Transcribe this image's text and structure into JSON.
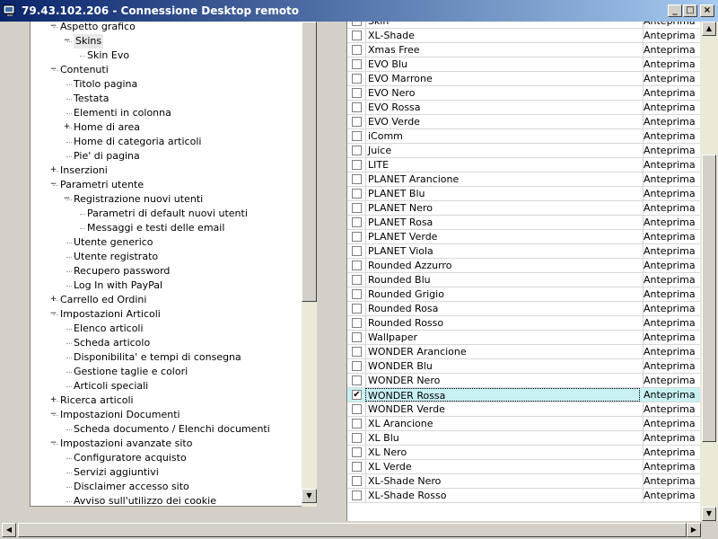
{
  "window": {
    "title": "79.43.102.206 - Connessione Desktop remoto"
  },
  "tree": [
    {
      "label": "Aspetto grafico",
      "level": 1,
      "expander": "minus"
    },
    {
      "label": "Skins",
      "level": 2,
      "expander": "minus",
      "selected": true
    },
    {
      "label": "Skin Evo",
      "level": 3,
      "expander": ""
    },
    {
      "label": "Contenuti",
      "level": 1,
      "expander": "minus"
    },
    {
      "label": "Titolo pagina",
      "level": 2,
      "expander": ""
    },
    {
      "label": "Testata",
      "level": 2,
      "expander": ""
    },
    {
      "label": "Elementi in colonna",
      "level": 2,
      "expander": ""
    },
    {
      "label": "Home di area",
      "level": 2,
      "expander": "plus"
    },
    {
      "label": "Home di categoria articoli",
      "level": 2,
      "expander": ""
    },
    {
      "label": "Pie' di pagina",
      "level": 2,
      "expander": ""
    },
    {
      "label": "Inserzioni",
      "level": 1,
      "expander": "plus"
    },
    {
      "label": "Parametri utente",
      "level": 1,
      "expander": "minus"
    },
    {
      "label": "Registrazione nuovi utenti",
      "level": 2,
      "expander": "minus"
    },
    {
      "label": "Parametri di default nuovi utenti",
      "level": 3,
      "expander": ""
    },
    {
      "label": "Messaggi e testi delle email",
      "level": 3,
      "expander": ""
    },
    {
      "label": "Utente generico",
      "level": 2,
      "expander": ""
    },
    {
      "label": "Utente registrato",
      "level": 2,
      "expander": ""
    },
    {
      "label": "Recupero password",
      "level": 2,
      "expander": ""
    },
    {
      "label": "Log In with PayPal",
      "level": 2,
      "expander": ""
    },
    {
      "label": "Carrello ed Ordini",
      "level": 1,
      "expander": "plus"
    },
    {
      "label": "Impostazioni Articoli",
      "level": 1,
      "expander": "minus"
    },
    {
      "label": "Elenco articoli",
      "level": 2,
      "expander": ""
    },
    {
      "label": "Scheda articolo",
      "level": 2,
      "expander": ""
    },
    {
      "label": "Disponibilita' e tempi di consegna",
      "level": 2,
      "expander": ""
    },
    {
      "label": "Gestione taglie e colori",
      "level": 2,
      "expander": ""
    },
    {
      "label": "Articoli speciali",
      "level": 2,
      "expander": ""
    },
    {
      "label": "Ricerca articoli",
      "level": 1,
      "expander": "plus"
    },
    {
      "label": "Impostazioni Documenti",
      "level": 1,
      "expander": "minus"
    },
    {
      "label": "Scheda documento / Elenchi documenti",
      "level": 2,
      "expander": ""
    },
    {
      "label": "Impostazioni avanzate sito",
      "level": 1,
      "expander": "minus"
    },
    {
      "label": "Configuratore acquisto",
      "level": 2,
      "expander": ""
    },
    {
      "label": "Servizi aggiuntivi",
      "level": 2,
      "expander": ""
    },
    {
      "label": "Disclaimer accesso sito",
      "level": 2,
      "expander": ""
    },
    {
      "label": "Avviso sull'utilizzo dei cookie",
      "level": 2,
      "expander": ""
    }
  ],
  "grid": {
    "preview_label": "Anteprima",
    "rows": [
      {
        "name": "Skin",
        "checked": false
      },
      {
        "name": "XL-Shade",
        "checked": false
      },
      {
        "name": "Xmas Free",
        "checked": false
      },
      {
        "name": "EVO Blu",
        "checked": false
      },
      {
        "name": "EVO Marrone",
        "checked": false
      },
      {
        "name": "EVO Nero",
        "checked": false
      },
      {
        "name": "EVO Rossa",
        "checked": false
      },
      {
        "name": "EVO Verde",
        "checked": false
      },
      {
        "name": "iComm",
        "checked": false
      },
      {
        "name": "Juice",
        "checked": false
      },
      {
        "name": "LITE",
        "checked": false
      },
      {
        "name": "PLANET Arancione",
        "checked": false
      },
      {
        "name": "PLANET Blu",
        "checked": false
      },
      {
        "name": "PLANET Nero",
        "checked": false
      },
      {
        "name": "PLANET Rosa",
        "checked": false
      },
      {
        "name": "PLANET Verde",
        "checked": false
      },
      {
        "name": "PLANET Viola",
        "checked": false
      },
      {
        "name": "Rounded Azzurro",
        "checked": false
      },
      {
        "name": "Rounded Blu",
        "checked": false
      },
      {
        "name": "Rounded Grigio",
        "checked": false
      },
      {
        "name": "Rounded Rosa",
        "checked": false
      },
      {
        "name": "Rounded Rosso",
        "checked": false
      },
      {
        "name": "Wallpaper",
        "checked": false
      },
      {
        "name": "WONDER Arancione",
        "checked": false
      },
      {
        "name": "WONDER Blu",
        "checked": false
      },
      {
        "name": "WONDER Nero",
        "checked": false
      },
      {
        "name": "WONDER Rossa",
        "checked": true,
        "selected": true
      },
      {
        "name": "WONDER Verde",
        "checked": false
      },
      {
        "name": "XL Arancione",
        "checked": false
      },
      {
        "name": "XL Blu",
        "checked": false
      },
      {
        "name": "XL Nero",
        "checked": false
      },
      {
        "name": "XL Verde",
        "checked": false
      },
      {
        "name": "XL-Shade Nero",
        "checked": false
      },
      {
        "name": "XL-Shade Rosso",
        "checked": false
      }
    ]
  },
  "colors": {
    "titlebar_start": "#0a246a",
    "titlebar_end": "#a6caf0",
    "selected_row": "#c9f1f4"
  }
}
